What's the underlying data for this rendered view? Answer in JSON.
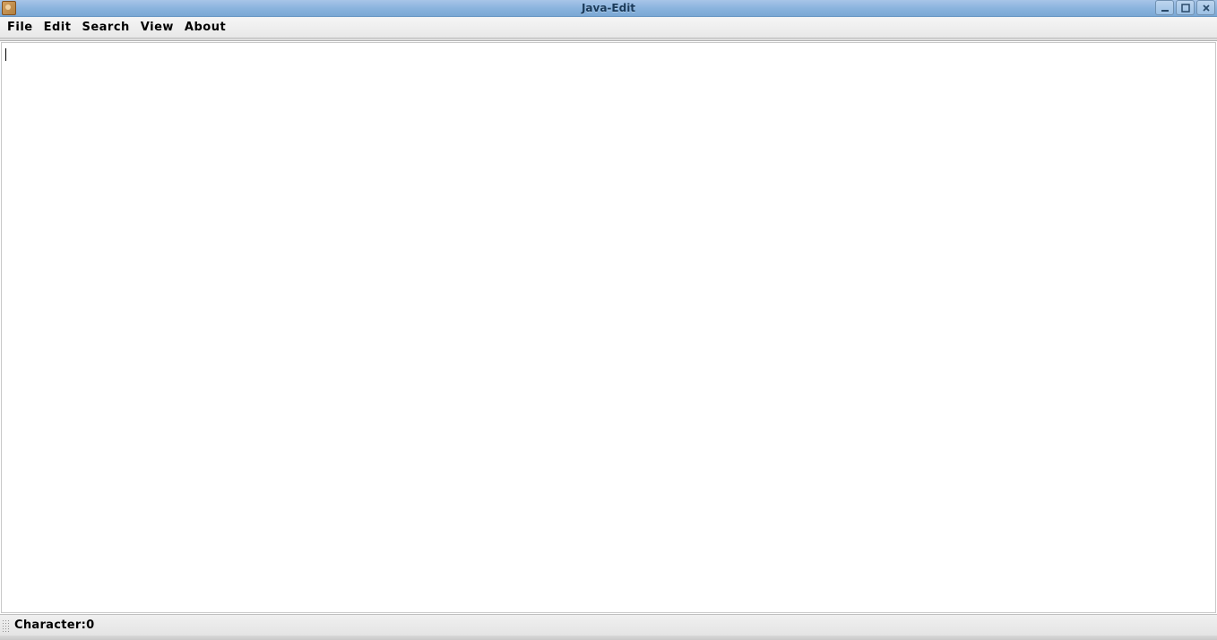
{
  "window": {
    "title": "Java-Edit"
  },
  "menubar": {
    "items": [
      {
        "label": "File"
      },
      {
        "label": "Edit"
      },
      {
        "label": "Search"
      },
      {
        "label": "View"
      },
      {
        "label": "About"
      }
    ]
  },
  "editor": {
    "content": ""
  },
  "statusbar": {
    "characterLabel": "Character:",
    "characterCount": "0"
  }
}
